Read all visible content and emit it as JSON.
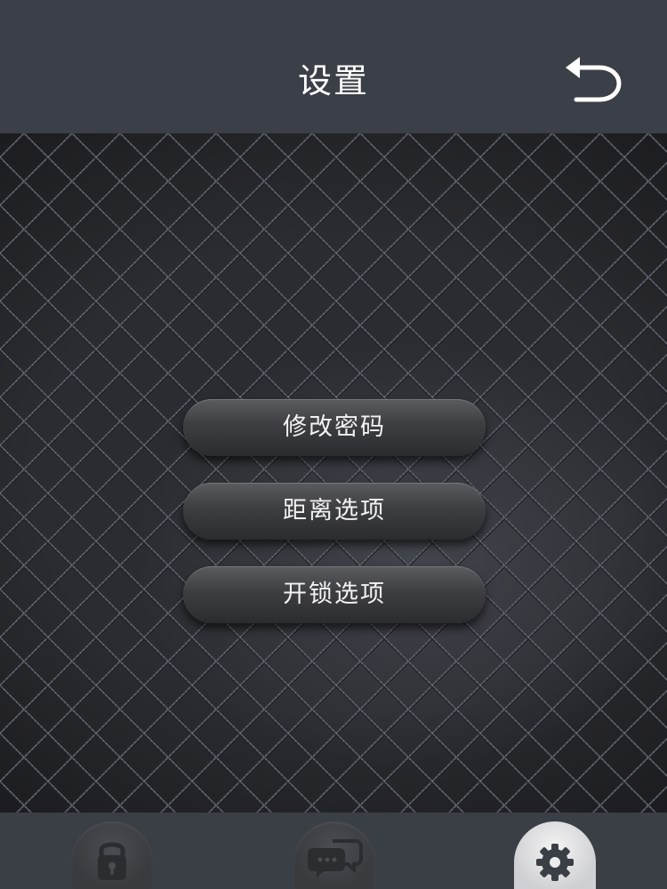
{
  "header": {
    "title": "设置",
    "back_icon": "undo-arrow-icon"
  },
  "menu": {
    "items": [
      {
        "label": "修改密码"
      },
      {
        "label": "距离选项"
      },
      {
        "label": "开锁选项"
      }
    ]
  },
  "bottom_nav": {
    "items": [
      {
        "icon": "lock-icon",
        "active": false
      },
      {
        "icon": "chat-bubbles-icon",
        "active": false
      },
      {
        "icon": "gear-icon",
        "active": true
      }
    ]
  },
  "colors": {
    "header_bg": "#3b4048",
    "footer_bg": "#3a3e45",
    "content_bg": "#2b2c31",
    "button_text": "#f2f2f2",
    "active_nav": "#e6e6e6"
  }
}
